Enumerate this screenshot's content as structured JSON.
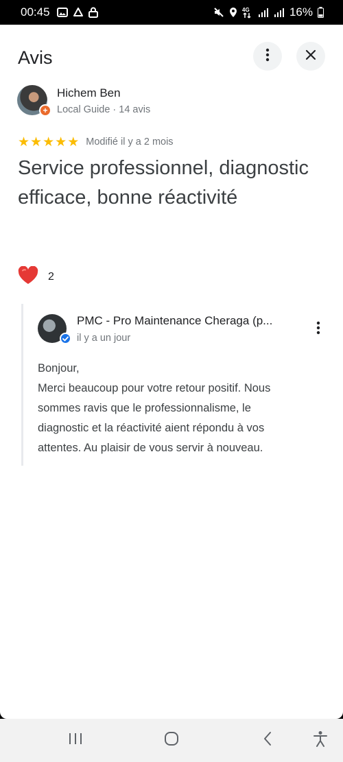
{
  "status_bar": {
    "time": "00:45",
    "battery": "16%",
    "network": "4G",
    "left_icons": [
      "image-icon",
      "recycle-icon",
      "lock-icon"
    ],
    "right_icons": [
      "mute-icon",
      "location-icon",
      "network-4g-icon",
      "signal-icon",
      "signal-icon-2",
      "battery-icon"
    ]
  },
  "header": {
    "title": "Avis",
    "more_icon": "more-vert-icon",
    "close_icon": "close-icon"
  },
  "review": {
    "reviewer_name": "Hichem Ben",
    "reviewer_sub": "Local Guide · 14 avis",
    "badge_icon": "local-guide-badge-icon",
    "rating": 5,
    "rating_max": 5,
    "star_color": "#fbbc04",
    "date": "Modifié il y a 2 mois",
    "text": "Service professionnel, diagnostic efficace, bonne réactivité",
    "reaction_icon": "heart-icon",
    "reaction_count": "2"
  },
  "owner_reply": {
    "name": "PMC - Pro Maintenance Cheraga (p...",
    "date": "il y a un jour",
    "verified_icon": "verified-check-icon",
    "text_lines": [
      "Bonjour,",
      "Merci beaucoup pour votre retour positif. Nous",
      "sommes ravis que le professionnalisme, le",
      "diagnostic et la réactivité aient répondu à vos",
      "attentes. Au plaisir de vous servir à nouveau."
    ]
  },
  "nav_bar": {
    "icons": [
      "recent-apps-icon",
      "home-icon",
      "back-icon",
      "accessibility-icon"
    ]
  },
  "colors": {
    "accent_blue": "#1a73e8",
    "guide_orange": "#ea6b2c",
    "heart_red": "#e53935",
    "secondary_text": "#70757a"
  }
}
